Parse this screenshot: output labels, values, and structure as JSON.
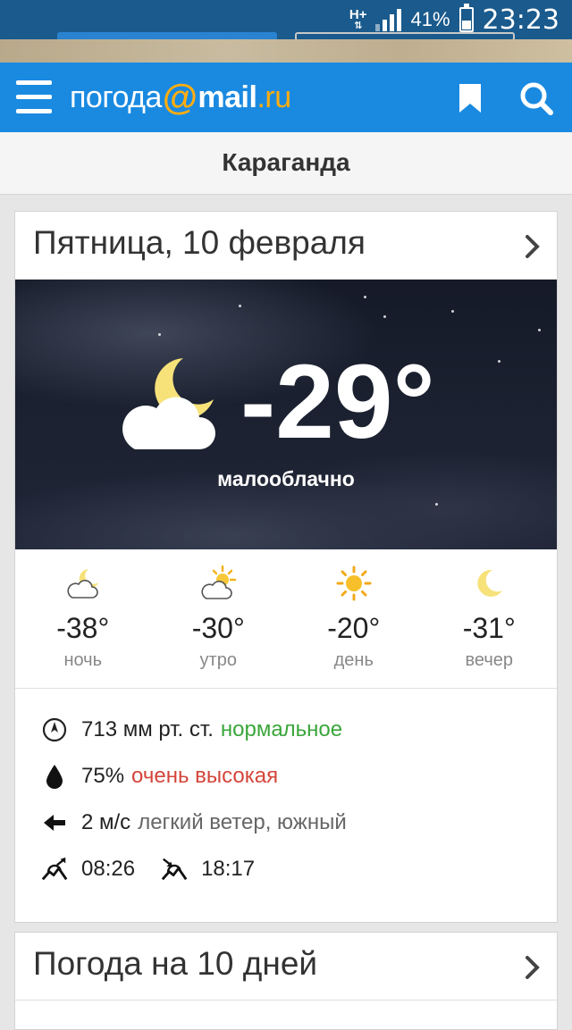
{
  "status_bar": {
    "network": "H+",
    "battery_percent": "41%",
    "battery_level": 0.41,
    "time": "23:23"
  },
  "app": {
    "logo_part1": "погода",
    "logo_at": "@",
    "logo_mail": "mail",
    "logo_dot": ".",
    "logo_ru": "ru",
    "icons": {
      "menu": "hamburger-icon",
      "bookmark": "bookmark-icon",
      "search": "search-icon"
    },
    "colors": {
      "header": "#1a8ae1",
      "accent": "#ffad10",
      "green": "#3aa63a",
      "red": "#d4453a"
    }
  },
  "city": "Караганда",
  "today": {
    "date_title": "Пятница, 10 февраля",
    "temperature": "-29°",
    "condition": "малооблачно",
    "periods": [
      {
        "temp": "-38°",
        "name": "ночь",
        "icon": "moon-cloud-icon"
      },
      {
        "temp": "-30°",
        "name": "утро",
        "icon": "sun-cloud-icon"
      },
      {
        "temp": "-20°",
        "name": "день",
        "icon": "sun-icon"
      },
      {
        "temp": "-31°",
        "name": "вечер",
        "icon": "moon-icon"
      }
    ],
    "pressure": {
      "value": "713 мм рт. ст.",
      "status": "нормальное"
    },
    "humidity": {
      "value": "75%",
      "status": "очень высокая"
    },
    "wind": {
      "value": "2 м/с",
      "description": "легкий ветер, южный"
    },
    "sunrise": "08:26",
    "sunset": "18:17"
  },
  "forecast_10": {
    "title": "Погода на 10 дней"
  }
}
